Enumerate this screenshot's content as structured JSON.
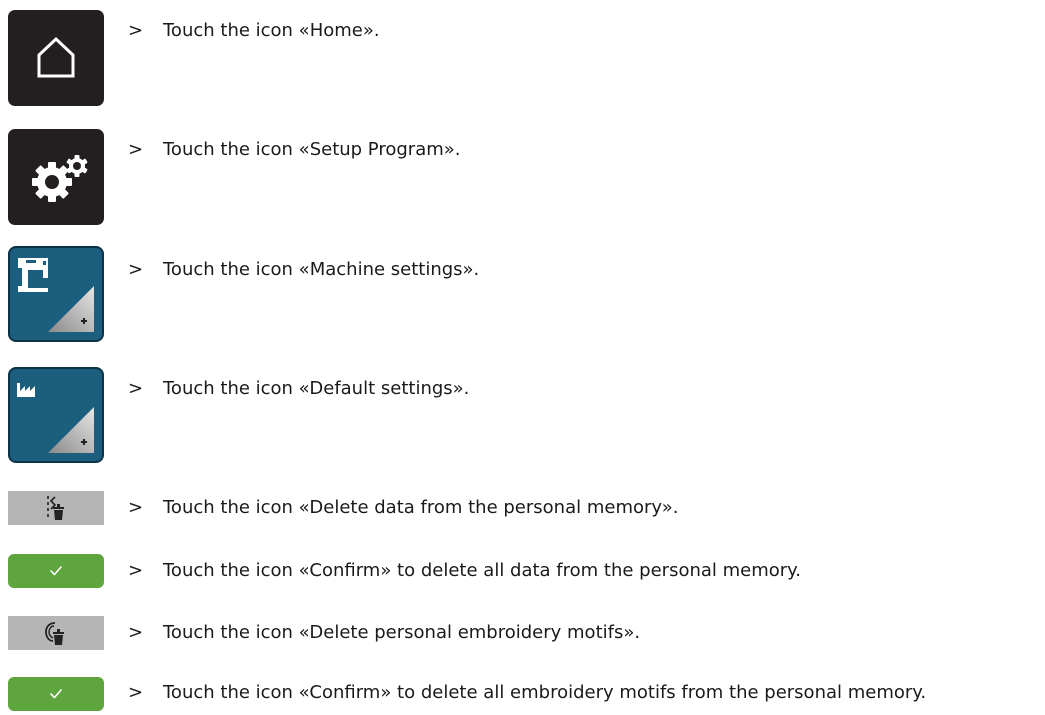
{
  "steps": [
    {
      "arrow": ">",
      "text": "Touch the icon «Home».",
      "icon": "home-icon"
    },
    {
      "arrow": ">",
      "text": "Touch the icon «Setup Program».",
      "icon": "gears-icon"
    },
    {
      "arrow": ">",
      "text": "Touch the icon «Machine settings».",
      "icon": "sewing-machine-icon"
    },
    {
      "arrow": ">",
      "text": "Touch the icon «Default settings».",
      "icon": "factory-icon"
    },
    {
      "arrow": ">",
      "text": "Touch the icon «Delete data from the personal memory».",
      "icon": "stitch-trash-icon"
    },
    {
      "arrow": ">",
      "text": "Touch the icon «Confirm» to delete all data from the personal memory.",
      "icon": "checkmark-icon"
    },
    {
      "arrow": ">",
      "text": "Touch the icon «Delete personal embroidery motifs».",
      "icon": "hoop-trash-icon"
    },
    {
      "arrow": ">",
      "text": "Touch the icon «Confirm» to delete all embroidery motifs from the personal memory.",
      "icon": "checkmark-icon"
    }
  ],
  "colors": {
    "dark_tile": "#231f20",
    "blue_tile": "#1b5e7d",
    "grey_button": "#b5b5b5",
    "green_button": "#5da53c"
  }
}
